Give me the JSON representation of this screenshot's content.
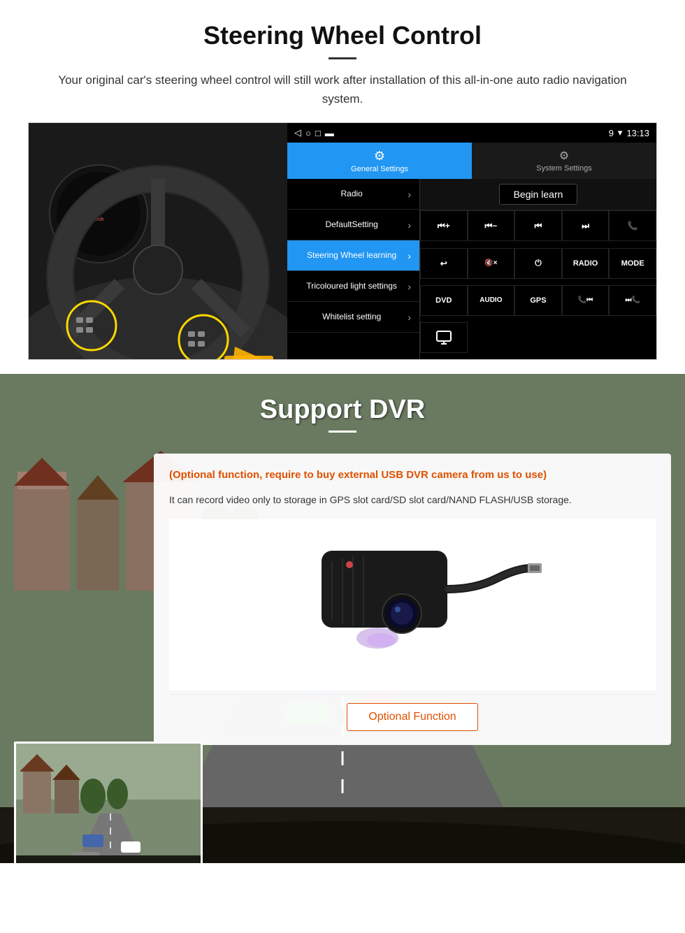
{
  "steering": {
    "title": "Steering Wheel Control",
    "description": "Your original car's steering wheel control will still work after installation of this all-in-one auto radio navigation system.",
    "android_ui": {
      "status_bar": {
        "time": "13:13",
        "signal": "▼",
        "wifi": "▾"
      },
      "tabs": [
        {
          "id": "general",
          "label": "General Settings",
          "active": true
        },
        {
          "id": "system",
          "label": "System Settings",
          "active": false
        }
      ],
      "menu_items": [
        {
          "label": "Radio",
          "has_arrow": true,
          "highlighted": false
        },
        {
          "label": "DefaultSetting",
          "has_arrow": true,
          "highlighted": false
        },
        {
          "label": "Steering Wheel learning",
          "has_arrow": true,
          "highlighted": true
        },
        {
          "label": "Tricoloured light settings",
          "has_arrow": true,
          "highlighted": false
        },
        {
          "label": "Whitelist setting",
          "has_arrow": true,
          "highlighted": false
        }
      ],
      "begin_learn": "Begin learn",
      "control_buttons": [
        "⏮+",
        "⏮−",
        "⏮◀",
        "▶⏭",
        "📞",
        "↩",
        "🔇×",
        "⏻",
        "RADIO",
        "MODE",
        "DVD",
        "AUDIO",
        "GPS",
        "📞⏮",
        "⏭📞"
      ]
    }
  },
  "dvr": {
    "title": "Support DVR",
    "optional_text": "(Optional function, require to buy external USB DVR camera from us to use)",
    "description": "It can record video only to storage in GPS slot card/SD slot card/NAND FLASH/USB storage.",
    "optional_function_label": "Optional Function"
  }
}
